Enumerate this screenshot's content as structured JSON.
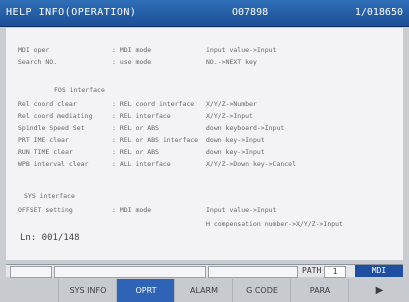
{
  "header": {
    "title": "HELP INFO(OPERATION)",
    "program": "O07898",
    "sequence": "1/018650"
  },
  "content": {
    "rows": [
      {
        "c1": "MDI oper",
        "c2": ": MDI mode",
        "c3": "input value->Input"
      },
      {
        "c1": "Search NO.",
        "c2": ": use mode",
        "c3": "NO.->NEXT key"
      },
      {
        "section": "FOS interface"
      },
      {
        "c1": "Rel coord clear",
        "c2": ": REL coord interface",
        "c3": "X/Y/Z->Number"
      },
      {
        "c1": "Rel coord mediating",
        "c2": ": REL interface",
        "c3": "X/Y/Z->Input"
      },
      {
        "c1": "Spindle Speed Set",
        "c2": ": REL or ABS",
        "c3": "down keyboard->Input"
      },
      {
        "c1": "PRT IME clear",
        "c2": ": REL or ABS interface",
        "c3": "down key->Input"
      },
      {
        "c1": "RUN TIME clear",
        "c2": ": REL or ABS",
        "c3": "down key->Input"
      },
      {
        "c1": "WPB interval clear",
        "c2": ": ALL interface",
        "c3": "X/Y/Z->Down key->Cancel"
      },
      {
        "section2": "SYS interface"
      },
      {
        "c1": "OFFSET setting",
        "c2": ": MDI mode",
        "c3": "Input value->Input"
      },
      {
        "c3": "H compensation number->X/Y/Z->Input"
      }
    ],
    "line_info": "Ln: 001/148"
  },
  "path_bar": {
    "label": "PATH",
    "value": "1",
    "mode": "MDI"
  },
  "softkeys": [
    {
      "label": "",
      "active": false
    },
    {
      "label": "SYS INFO",
      "active": false
    },
    {
      "label": "OPRT",
      "active": true
    },
    {
      "label": "ALARM",
      "active": false
    },
    {
      "label": "G CODE",
      "active": false
    },
    {
      "label": "PARA",
      "active": false
    },
    {
      "label": "▶",
      "active": false
    }
  ]
}
